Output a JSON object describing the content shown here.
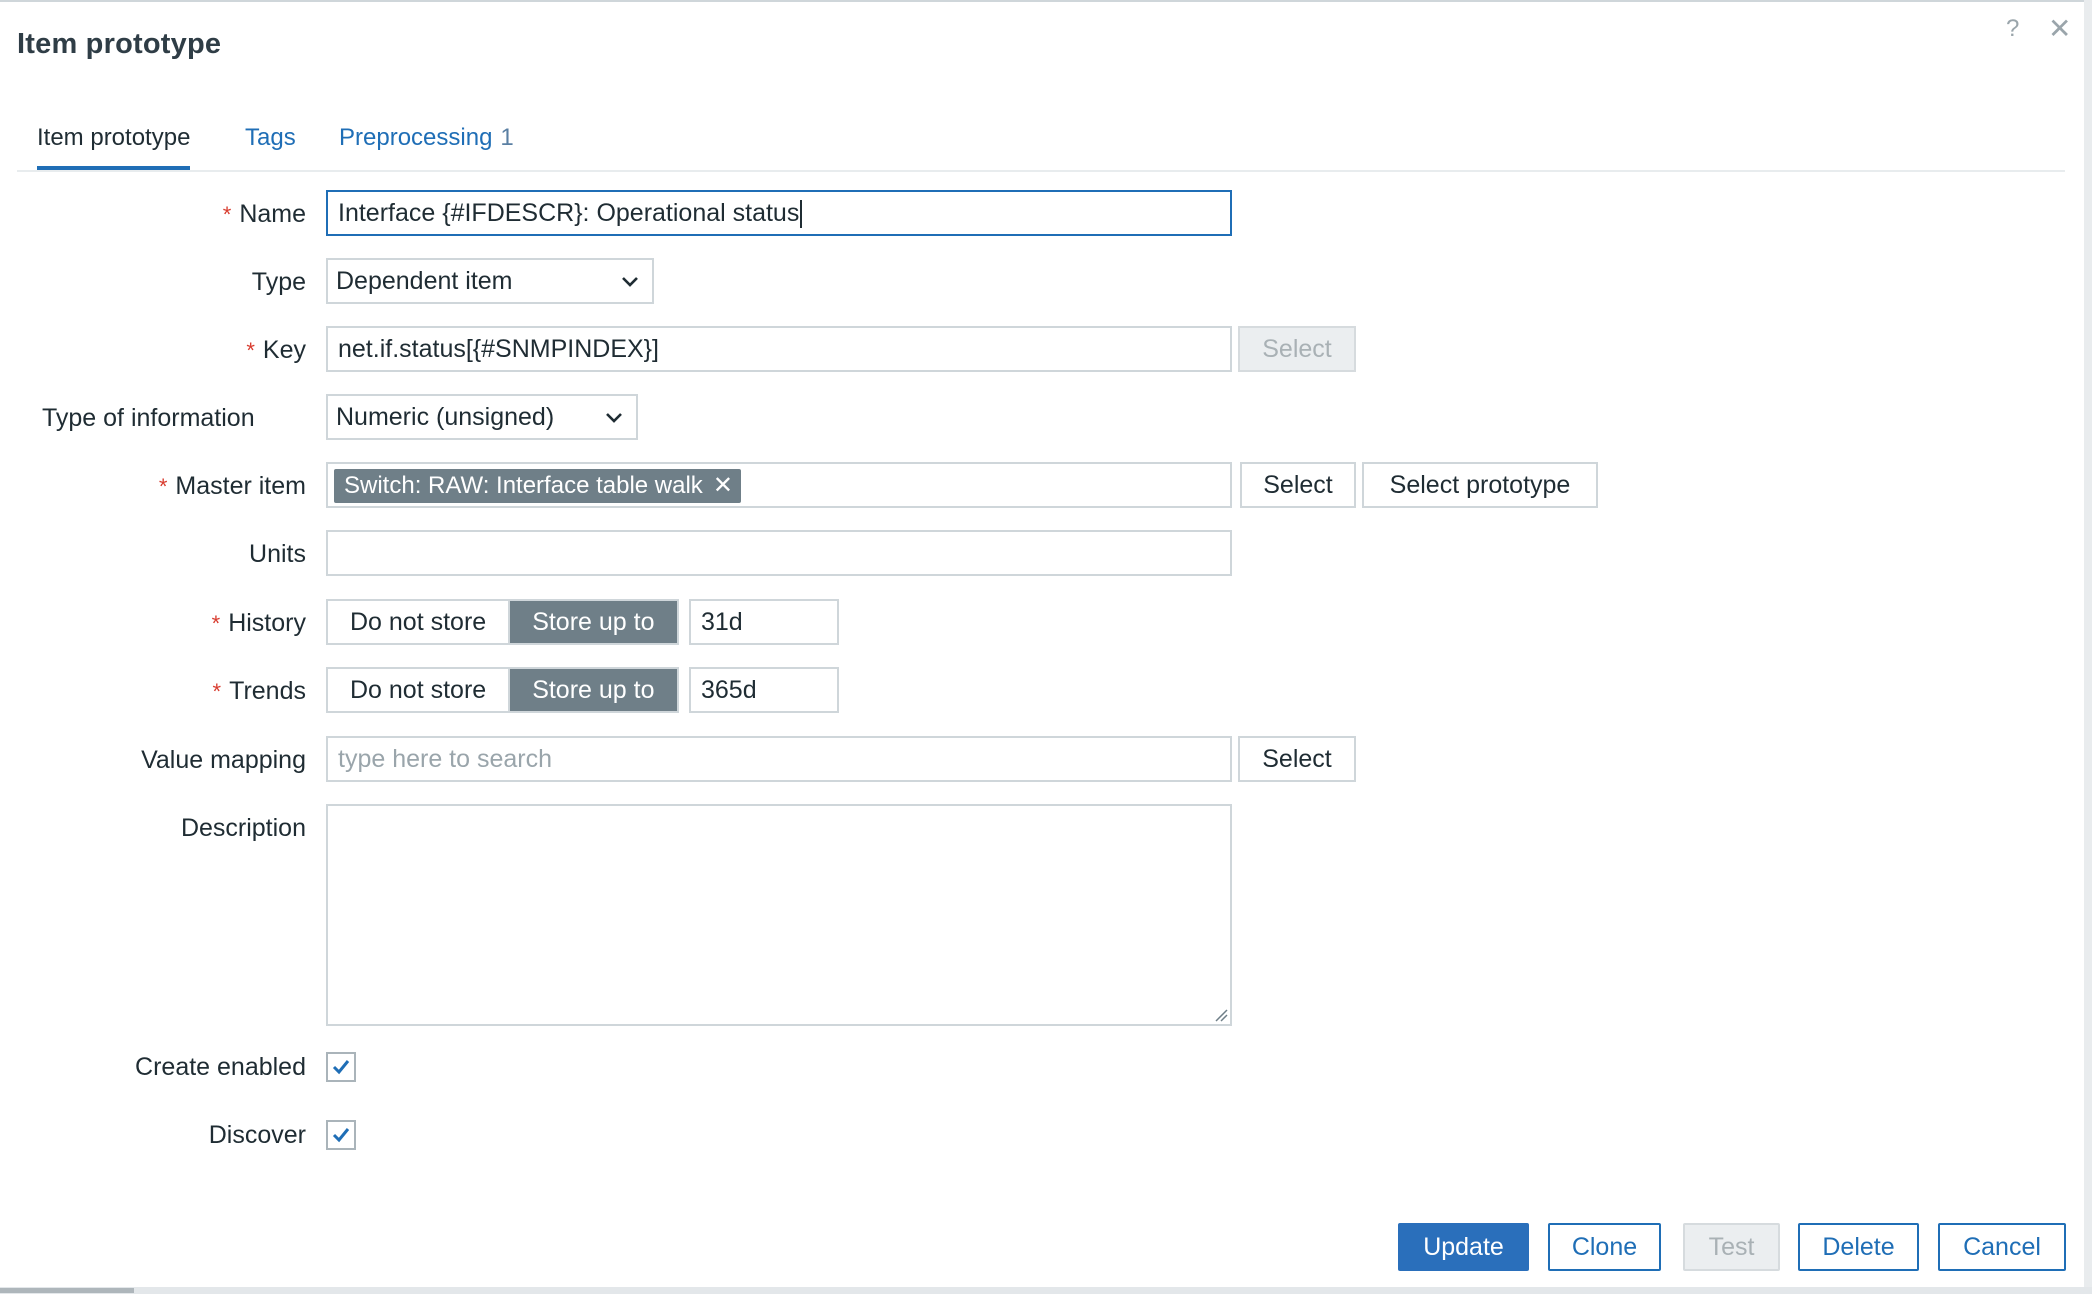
{
  "dialog": {
    "title": "Item prototype",
    "help_icon": "?",
    "close_icon": "✕"
  },
  "tabs": [
    {
      "label": "Item prototype",
      "active": true
    },
    {
      "label": "Tags",
      "active": false
    },
    {
      "label": "Preprocessing",
      "count": "1",
      "active": false
    }
  ],
  "form": {
    "name": {
      "label": "Name",
      "required": "*",
      "value": "Interface {#IFDESCR}: Operational status"
    },
    "type": {
      "label": "Type",
      "value": "Dependent item"
    },
    "key": {
      "label": "Key",
      "required": "*",
      "value": "net.if.status[{#SNMPINDEX}]",
      "select_button": "Select"
    },
    "type_of_information": {
      "label": "Type of information",
      "value": "Numeric (unsigned)"
    },
    "master_item": {
      "label": "Master item",
      "required": "*",
      "chip": "Switch: RAW: Interface table walk",
      "chip_remove": "✕",
      "select_button": "Select",
      "select_prototype_button": "Select prototype"
    },
    "units": {
      "label": "Units",
      "value": ""
    },
    "history": {
      "label": "History",
      "required": "*",
      "option_off": "Do not store",
      "option_on": "Store up to",
      "value": "31d"
    },
    "trends": {
      "label": "Trends",
      "required": "*",
      "option_off": "Do not store",
      "option_on": "Store up to",
      "value": "365d"
    },
    "value_mapping": {
      "label": "Value mapping",
      "placeholder": "type here to search",
      "select_button": "Select"
    },
    "description": {
      "label": "Description",
      "value": ""
    },
    "create_enabled": {
      "label": "Create enabled",
      "checked": true
    },
    "discover": {
      "label": "Discover",
      "checked": true
    }
  },
  "footer": {
    "update": "Update",
    "clone": "Clone",
    "test": "Test",
    "delete": "Delete",
    "cancel": "Cancel"
  },
  "colors": {
    "accent": "#1f6eb6",
    "required": "#d83b2e",
    "segment_active": "#6f7f88"
  }
}
